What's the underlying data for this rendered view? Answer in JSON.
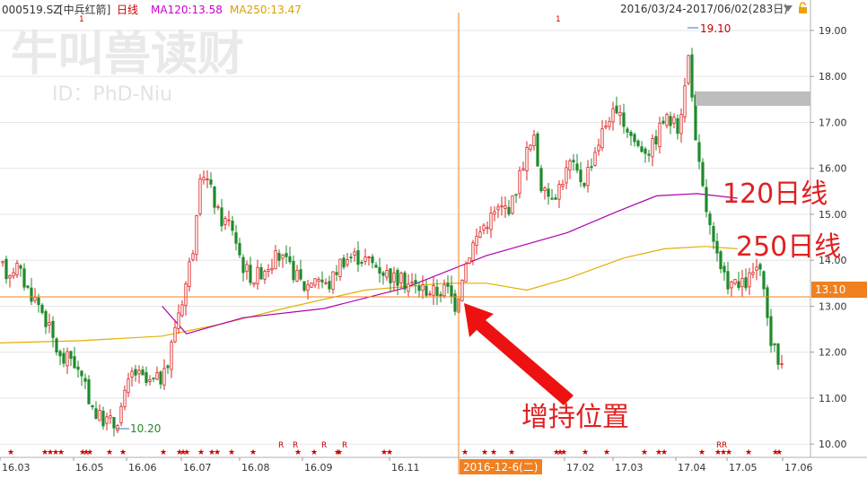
{
  "header": {
    "code": "000519.SZ",
    "name": "[中兵红箭]",
    "period": "日线",
    "ma120_label": "MA120:13.58",
    "ma250_label": "MA250:13.47",
    "range": "2016/03/24-2017/06/02(283日)"
  },
  "watermark": {
    "line1": "牛叫兽读财",
    "line2": "ID：PhD-Niu"
  },
  "annotations": {
    "label_120": "120日线",
    "label_250": "250日线",
    "arrow_label": "增持位置",
    "high_label": "19.10",
    "low_label": "10.20",
    "crosshair_price": "13.10",
    "crosshair_date": "2016-12-6(二)",
    "marker_1": "1",
    "marker_2": "1"
  },
  "chart_data": {
    "type": "candlestick",
    "title": "",
    "xlabel": "",
    "ylabel": "",
    "ylim": [
      9.75,
      19.35
    ],
    "y_ticks": [
      "19.00",
      "18.00",
      "17.00",
      "16.00",
      "15.00",
      "14.00",
      "13.00",
      "12.00",
      "11.00",
      "10.00"
    ],
    "x_ticks": [
      "16.03",
      "16.05",
      "16.06",
      "16.07",
      "16.08",
      "16.09",
      "16.11",
      "17.02",
      "17.03",
      "17.04",
      "17.05",
      "17.06"
    ],
    "highlight_price": 13.1,
    "high": 19.1,
    "low": 10.2,
    "ma120_anchor": [
      [
        0.2,
        13.0
      ],
      [
        0.23,
        12.4
      ],
      [
        0.3,
        12.75
      ],
      [
        0.4,
        12.95
      ],
      [
        0.5,
        13.4
      ],
      [
        0.6,
        14.1
      ],
      [
        0.7,
        14.6
      ],
      [
        0.76,
        15.05
      ],
      [
        0.81,
        15.4
      ],
      [
        0.86,
        15.45
      ],
      [
        0.91,
        15.35
      ]
    ],
    "ma250_anchor": [
      [
        0.0,
        12.2
      ],
      [
        0.1,
        12.25
      ],
      [
        0.2,
        12.35
      ],
      [
        0.27,
        12.6
      ],
      [
        0.35,
        12.95
      ],
      [
        0.45,
        13.35
      ],
      [
        0.55,
        13.5
      ],
      [
        0.6,
        13.5
      ],
      [
        0.65,
        13.35
      ],
      [
        0.7,
        13.6
      ],
      [
        0.77,
        14.05
      ],
      [
        0.82,
        14.25
      ],
      [
        0.87,
        14.3
      ],
      [
        0.91,
        14.25
      ]
    ]
  }
}
